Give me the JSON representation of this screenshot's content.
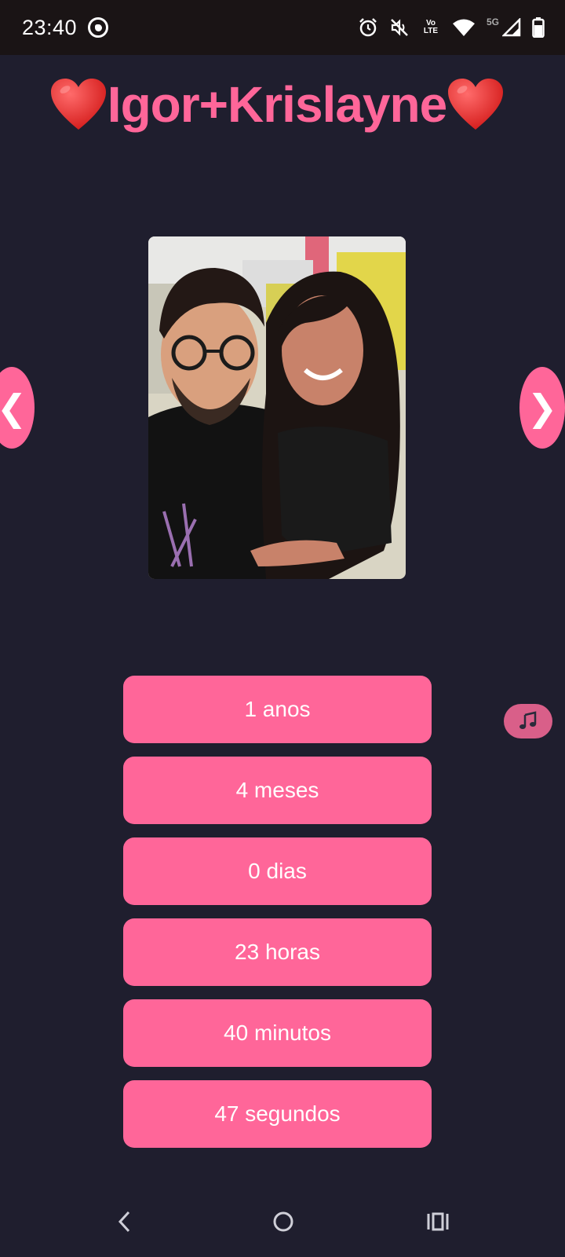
{
  "status_bar": {
    "time": "23:40",
    "icons": [
      "whatsapp-icon",
      "alarm-icon",
      "mute-icon",
      "volte-icon",
      "wifi-icon",
      "signal-5g-icon",
      "battery-icon"
    ],
    "volte_text": "Vo\nLTE",
    "network": "5G"
  },
  "header": {
    "title": "Igor+Krislayne",
    "heart_emoji": "❤️"
  },
  "carousel": {
    "prev_label": "❮",
    "next_label": "❯",
    "photo_alt": "couple selfie"
  },
  "counters": [
    {
      "value": "1 anos"
    },
    {
      "value": "4 meses"
    },
    {
      "value": "0 dias"
    },
    {
      "value": "23 horas"
    },
    {
      "value": "40 minutos"
    },
    {
      "value": "47 segundos"
    }
  ],
  "music_button": {
    "icon": "music-note-icon"
  },
  "nav_bar": {
    "icons": [
      "back-icon",
      "home-icon",
      "recents-icon"
    ]
  },
  "colors": {
    "background": "#1f1e2e",
    "accent": "#ff6699",
    "status_bar": "#1a1415"
  }
}
